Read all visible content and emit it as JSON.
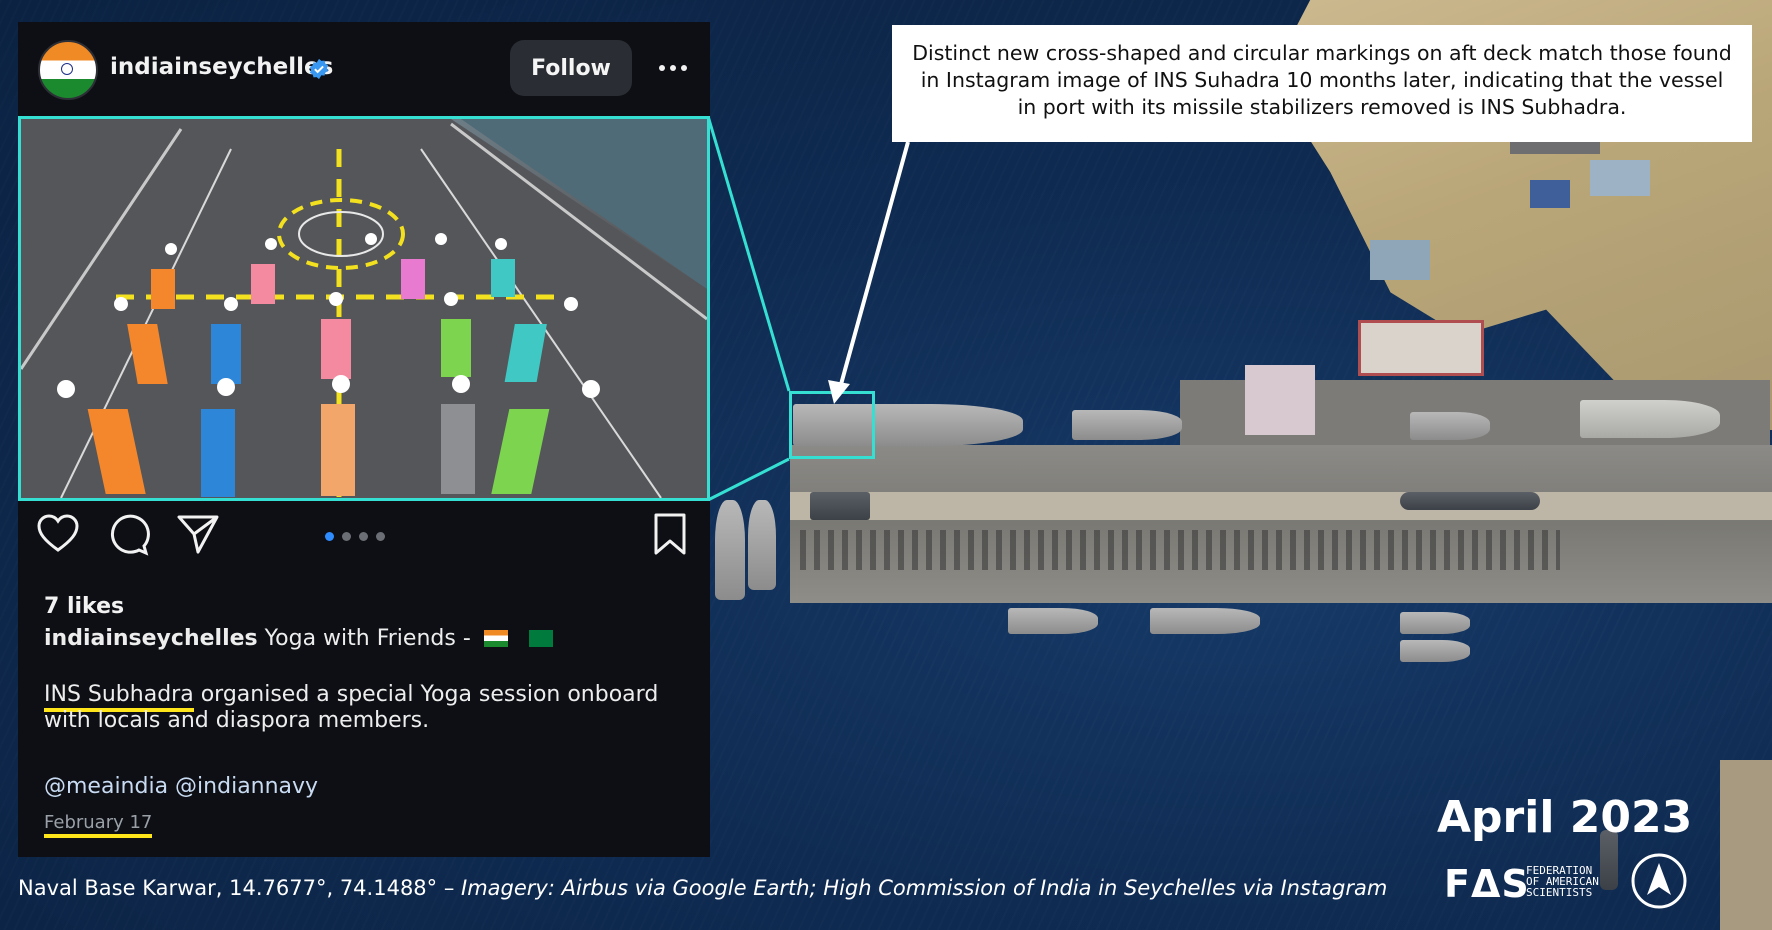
{
  "post": {
    "username": "indiainseychelles",
    "follow_label": "Follow",
    "likes": "7 likes",
    "caption_title": "Yoga with Friends -",
    "body_highlight": "INS Subhadra",
    "body_rest": " organised a special Yoga session onboard with locals and diaspora members.",
    "mentions": "@meaindia @indiannavy",
    "date": "February 17",
    "carousel_count": 4,
    "carousel_active": 1,
    "colors": {
      "verified": "#3897f0",
      "highlight_box": "#35e0d3",
      "underline": "#ffe61a"
    }
  },
  "annotation": {
    "text": "Distinct new cross-shaped and circular markings on aft deck match those found in Instagram image of INS Suhadra 10 months later, indicating that the vessel in port with its missile stabilizers removed is INS Subhadra."
  },
  "footer": {
    "location": "Naval Base Karwar, 14.7677°,  74.1488° – ",
    "source": "Imagery: Airbus via Google Earth; High Commission of India in Seychelles via Instagram",
    "date_stamp": "April 2023",
    "logo_mark": "FΔS",
    "logo_text_1": "FEDERATION",
    "logo_text_2": "OF AMERICAN",
    "logo_text_3": "SCIENTISTS"
  },
  "icons": [
    "verified-icon",
    "more-icon",
    "heart-icon",
    "comment-icon",
    "share-icon",
    "bookmark-icon",
    "north-arrow-icon"
  ]
}
